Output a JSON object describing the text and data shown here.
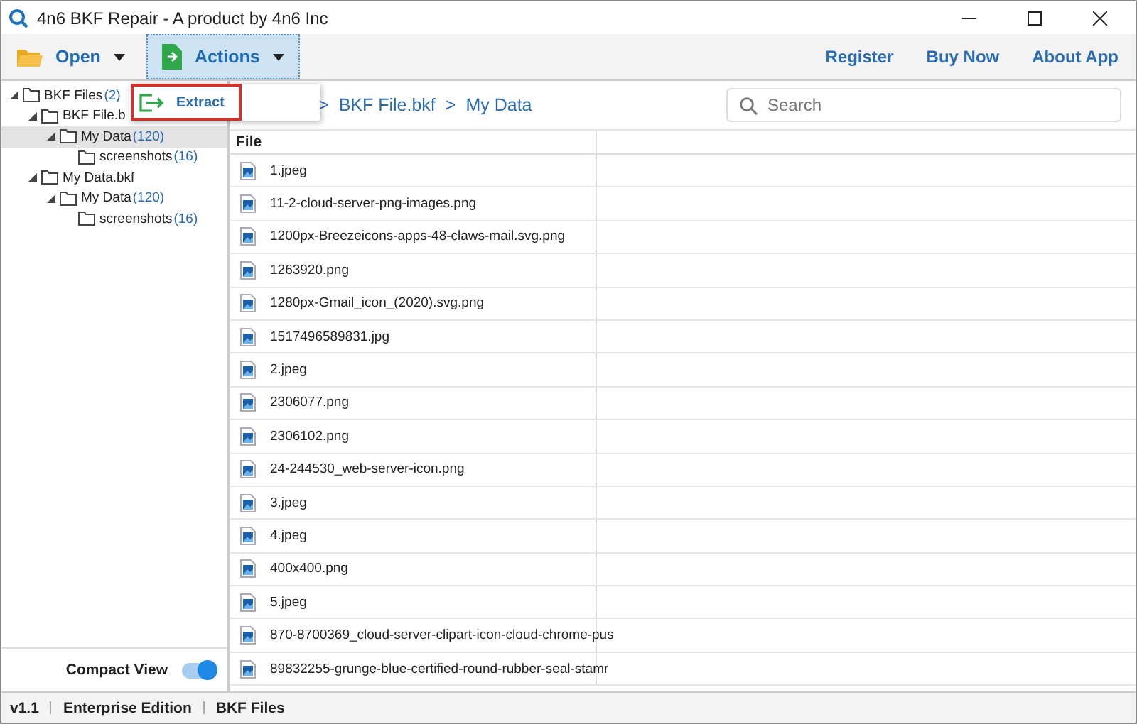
{
  "window": {
    "title": "4n6 BKF Repair - A product by 4n6 Inc"
  },
  "toolbar": {
    "open": "Open",
    "actions": "Actions",
    "links": [
      "Register",
      "Buy Now",
      "About App"
    ]
  },
  "actions_menu": {
    "items": [
      {
        "label": "Extract",
        "selected": true
      }
    ]
  },
  "tree": [
    {
      "label": "BKF Files",
      "count": "(2)",
      "selected": false,
      "expanded": true,
      "children": [
        {
          "label": "BKF File.b",
          "selected": false,
          "expanded": true,
          "children": [
            {
              "label": "My Data",
              "count": "(120)",
              "selected": true,
              "expanded": true,
              "children": [
                {
                  "label": "screenshots",
                  "count": "(16)",
                  "selected": false,
                  "expanded": false
                }
              ]
            }
          ]
        },
        {
          "label": "My Data.bkf",
          "selected": false,
          "expanded": true,
          "children": [
            {
              "label": "My Data",
              "count": "(120)",
              "selected": false,
              "expanded": true,
              "children": [
                {
                  "label": "screenshots",
                  "count": "(16)",
                  "selected": false,
                  "expanded": false
                }
              ]
            }
          ]
        }
      ]
    }
  ],
  "compact_view": {
    "label": "Compact View",
    "on": true
  },
  "breadcrumb": [
    {
      "separator": ">",
      "label": "BKF File.bkf"
    },
    {
      "separator": ">",
      "label": "My Data"
    }
  ],
  "search": {
    "placeholder": "Search"
  },
  "table": {
    "columns": [
      "File"
    ],
    "rows": [
      "1.jpeg",
      "11-2-cloud-server-png-images.png",
      "1200px-Breezeicons-apps-48-claws-mail.svg.png",
      "1263920.png",
      "1280px-Gmail_icon_(2020).svg.png",
      "1517496589831.jpg",
      "2.jpeg",
      "2306077.png",
      "2306102.png",
      "24-244530_web-server-icon.png",
      "3.jpeg",
      "4.jpeg",
      "400x400.png",
      "5.jpeg",
      "870-8700369_cloud-server-clipart-icon-cloud-chrome-pus",
      "89832255-grunge-blue-certified-round-rubber-seal-stamr"
    ]
  },
  "status_bar": [
    "v1.1",
    "Enterprise Edition",
    "BKF Files"
  ]
}
